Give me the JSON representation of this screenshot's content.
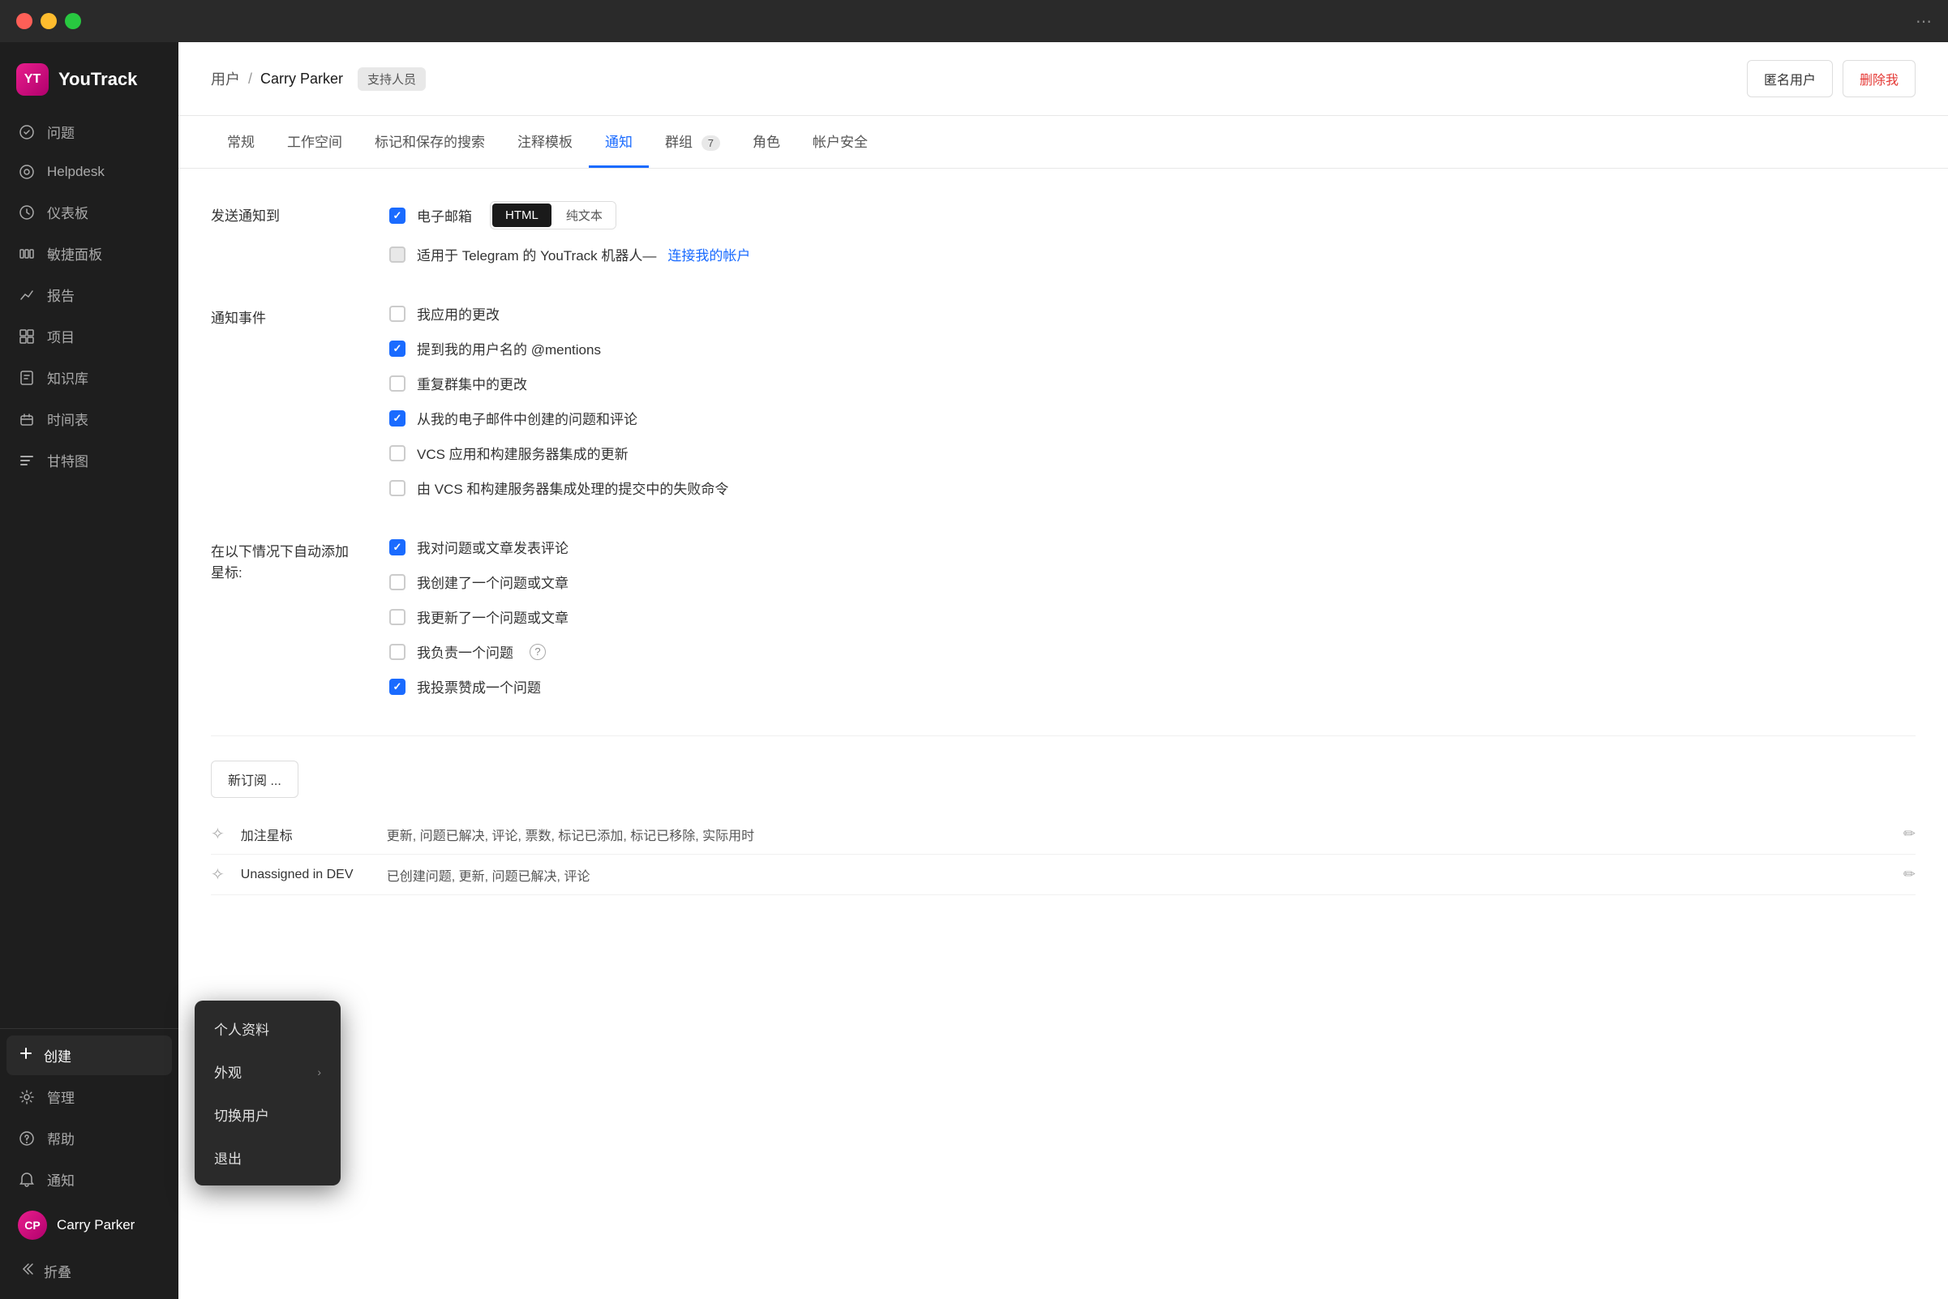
{
  "window": {
    "title": "YouTrack"
  },
  "titlebar": {
    "dots_icon": "●●●"
  },
  "sidebar": {
    "logo": "YT",
    "app_name": "YouTrack",
    "nav_items": [
      {
        "id": "issues",
        "label": "问题",
        "icon": "✓"
      },
      {
        "id": "helpdesk",
        "label": "Helpdesk",
        "icon": "○"
      },
      {
        "id": "dashboard",
        "label": "仪表板",
        "icon": "◎"
      },
      {
        "id": "agile",
        "label": "敏捷面板",
        "icon": "⊟"
      },
      {
        "id": "reports",
        "label": "报告",
        "icon": "↗"
      },
      {
        "id": "projects",
        "label": "项目",
        "icon": "⊞"
      },
      {
        "id": "knowledge",
        "label": "知识库",
        "icon": "📖"
      },
      {
        "id": "timetracking",
        "label": "时间表",
        "icon": "⧖"
      },
      {
        "id": "gantt",
        "label": "甘特图",
        "icon": "≡"
      }
    ],
    "bottom": {
      "create_label": "创建",
      "manage_label": "管理",
      "help_label": "帮助",
      "notifications_label": "通知",
      "user_name": "Carry Parker",
      "collapse_label": "折叠"
    }
  },
  "header": {
    "breadcrumb_users": "用户",
    "breadcrumb_sep": "/",
    "breadcrumb_current": "Carry Parker",
    "user_badge": "支持人员",
    "btn_anon": "匿名用户",
    "btn_delete": "删除我"
  },
  "tabs": [
    {
      "id": "general",
      "label": "常规",
      "active": false
    },
    {
      "id": "workspace",
      "label": "工作空间",
      "active": false
    },
    {
      "id": "tags",
      "label": "标记和保存的搜索",
      "active": false
    },
    {
      "id": "templates",
      "label": "注释模板",
      "active": false
    },
    {
      "id": "notifications",
      "label": "通知",
      "active": true
    },
    {
      "id": "groups",
      "label": "群组",
      "active": false,
      "badge": "7"
    },
    {
      "id": "roles",
      "label": "角色",
      "active": false
    },
    {
      "id": "security",
      "label": "帐户安全",
      "active": false
    }
  ],
  "notifications": {
    "send_to_label": "发送通知到",
    "email_label": "电子邮箱",
    "format_html": "HTML",
    "format_plain": "纯文本",
    "telegram_label": "适用于 Telegram 的 YouTrack 机器人—",
    "telegram_link": "连接我的帐户",
    "events_label": "通知事件",
    "auto_star_label": "在以下情况下自动添加\n星标:",
    "events": [
      {
        "id": "app_changes",
        "label": "我应用的更改",
        "checked": false
      },
      {
        "id": "mentions",
        "label": "提到我的用户名的 @mentions",
        "checked": true
      },
      {
        "id": "group_changes",
        "label": "重复群集中的更改",
        "checked": false
      },
      {
        "id": "email_issues",
        "label": "从我的电子邮件中创建的问题和评论",
        "checked": true
      },
      {
        "id": "vcs_updates",
        "label": "VCS 应用和构建服务器集成的更新",
        "checked": false
      },
      {
        "id": "vcs_failures",
        "label": "由 VCS 和构建服务器集成处理的提交中的失败命令",
        "checked": false
      }
    ],
    "star_events": [
      {
        "id": "commented",
        "label": "我对问题或文章发表评论",
        "checked": true
      },
      {
        "id": "created",
        "label": "我创建了一个问题或文章",
        "checked": false
      },
      {
        "id": "updated",
        "label": "我更新了一个问题或文章",
        "checked": false
      },
      {
        "id": "assigned",
        "label": "我负责一个问题",
        "checked": false,
        "has_help": true
      },
      {
        "id": "voted",
        "label": "我投票赞成一个问题",
        "checked": true
      }
    ],
    "new_sub_btn": "新订阅 ...",
    "sub_rows": [
      {
        "icon": "✧",
        "label": "加注星标",
        "values": "更新, 问题已解决, 评论, 票数, 标记已添加, 标记已移除, 实际用时"
      },
      {
        "icon": "✧",
        "label": "Unassigned in DEV",
        "values": "已创建问题, 更新, 问题已解决, 评论"
      }
    ]
  },
  "popup_menu": {
    "items": [
      {
        "id": "profile",
        "label": "个人资料",
        "has_chevron": false
      },
      {
        "id": "appearance",
        "label": "外观",
        "has_chevron": true
      },
      {
        "id": "switch_user",
        "label": "切换用户",
        "has_chevron": false
      },
      {
        "id": "logout",
        "label": "退出",
        "has_chevron": false
      }
    ]
  }
}
